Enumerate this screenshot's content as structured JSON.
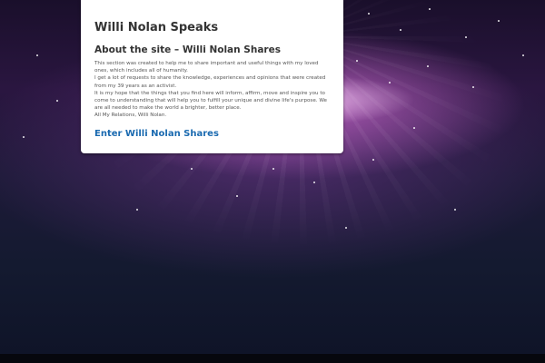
{
  "site": {
    "title": "Willi Nolan Speaks"
  },
  "about": {
    "heading": "About the site – Willi Nolan Shares",
    "paragraphs": [
      "This section was created to help me to share important and useful things with my loved ones, which includes all of humanity.",
      "I get a lot of requests to share the knowledge, experiences and opinions that were created from my 39 years as an activist.",
      "It is my hope that the things that you find here will inform, affirm, move and inspire you to come to understanding that will help you to fulfill your unique and divine life's purpose. We are all needed to make the world a brighter, better place.",
      "All My Relations, Willi Nolan."
    ],
    "enter_link": "Enter Willi Nolan Shares"
  },
  "colors": {
    "link": "#1a6ab0",
    "heading": "#333333",
    "body_text": "#555555",
    "panel_bg": "#ffffff"
  }
}
